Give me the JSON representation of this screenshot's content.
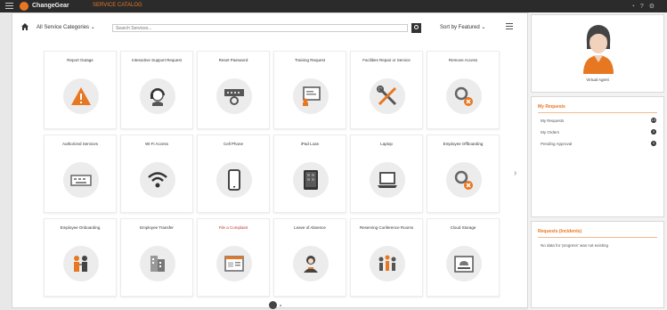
{
  "topbar": {
    "brand": "ChangeGear",
    "subtitle": "SERVICE CATALOG",
    "icons": [
      "user-icon",
      "help-icon",
      "settings-icon"
    ]
  },
  "toolbar": {
    "category_label": "All Service Categories ⌄",
    "search_placeholder": "Search Services...",
    "sort_label": "Sort by Featured ⌄"
  },
  "services": [
    {
      "label": "Report Outage",
      "icon": "warning-icon"
    },
    {
      "label": "Interactive Support Request",
      "icon": "support-agent-icon"
    },
    {
      "label": "Reset Password",
      "icon": "password-keypad-icon"
    },
    {
      "label": "Training Request",
      "icon": "training-board-icon"
    },
    {
      "label": "Facilities Repair or Service",
      "icon": "tools-icon"
    },
    {
      "label": "Remove Access",
      "icon": "remove-access-icon"
    },
    {
      "label": "Authorized Services",
      "icon": "keyboard-icon"
    },
    {
      "label": "Wi-Fi Access",
      "icon": "wifi-icon"
    },
    {
      "label": "Cell Phone",
      "icon": "cell-phone-icon"
    },
    {
      "label": "iPad Loan",
      "icon": "tablet-icon"
    },
    {
      "label": "Laptop",
      "icon": "laptop-icon"
    },
    {
      "label": "Employee Offboarding",
      "icon": "offboarding-icon"
    },
    {
      "label": "Employee Onboarding",
      "icon": "onboarding-icon"
    },
    {
      "label": "Employee Transfer",
      "icon": "transfer-icon"
    },
    {
      "label": "File a Complaint",
      "icon": "complaint-form-icon",
      "accent": true
    },
    {
      "label": "Leave of Absence",
      "icon": "person-icon"
    },
    {
      "label": "Reserving Conference Rooms",
      "icon": "conference-icon"
    },
    {
      "label": "Cloud Storage",
      "icon": "cloud-storage-icon"
    }
  ],
  "agent": {
    "label": "Virtual Agent"
  },
  "my_requests": {
    "title": "My Requests",
    "items": [
      {
        "label": "My Requests",
        "count": "10"
      },
      {
        "label": "My Orders",
        "count": "0"
      },
      {
        "label": "Pending Approval",
        "count": "0"
      }
    ]
  },
  "incidents": {
    "title": "Requests (Incidents)",
    "message": "No data for 'progress' was not existing"
  },
  "colors": {
    "accent": "#e87722",
    "topbar": "#2b2b2b",
    "icon_circle": "#ececec"
  }
}
